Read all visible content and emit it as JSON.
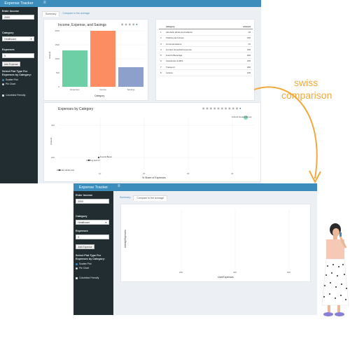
{
  "top": {
    "app_title": "Expense Tracker",
    "hamburger": "≡",
    "sidebar": {
      "income_label": "Enter Income",
      "income_value": "2000",
      "category_label": "Category",
      "category_value": "Healthcare",
      "expense_label": "Expenses",
      "expense_value": "5",
      "add_button": "Add Expense",
      "plot_type_label": "Select Plot Type For Expenses by Category:",
      "plot_options": [
        "Scatter Plot",
        "Pie Chart"
      ],
      "plot_selected": "Scatter Plot",
      "colorblind_label": "Colorblind Friendly"
    },
    "tabs": [
      "Summary",
      "Compare to the average"
    ],
    "active_tab": "Summary",
    "bar_chart": {
      "title": "Income, Expense, and Savings",
      "xlabel": "Category",
      "ylabel": "Amount",
      "categories": [
        "Expenses",
        "Income",
        "Savings"
      ],
      "values": [
        1300,
        2000,
        700
      ],
      "colors": [
        "#6ccfa5",
        "#fc8d62",
        "#8da0cb"
      ],
      "ylim": [
        0,
        2000
      ],
      "yticks": [
        "0",
        "500",
        "1000",
        "1500",
        "2000"
      ]
    },
    "table": {
      "headers": [
        "",
        "category",
        "amount"
      ],
      "rows": [
        [
          "1",
          "Alcoholic drinks and tobacco",
          "18"
        ],
        [
          "2",
          "Clothing and shoes",
          "150"
        ],
        [
          "3",
          "Communications",
          "15"
        ],
        [
          "4",
          "Current household expense",
          "150"
        ],
        [
          "5",
          "Food & Beverage",
          "200"
        ],
        [
          "6",
          "Insurances & ARS",
          "150"
        ],
        [
          "7",
          "Transport",
          "200"
        ],
        [
          "8",
          "Leisure",
          "100"
        ]
      ]
    },
    "scatter": {
      "title": "Expenses by Category",
      "xlabel": "% Share of Expenses",
      "ylabel": "Amount",
      "yticks": [
        "400",
        "200"
      ],
      "xticks": [
        "10",
        "20",
        "30",
        "40"
      ],
      "annotations": [
        "Current household exp",
        "Food & Bever",
        "Clothing and sh",
        "Alcoholic drinks and"
      ]
    }
  },
  "annotation": {
    "text_line1": "swiss",
    "text_line2": "comparison",
    "color": "#f1a93b"
  },
  "bottom": {
    "app_title": "Expense Tracker",
    "hamburger": "≡",
    "sidebar": {
      "income_label": "Enter Income",
      "income_value": "2000",
      "category_label": "Category",
      "category_value": "Healthcare",
      "expense_label": "Expenses",
      "expense_value": "0",
      "add_button": "Add Expense",
      "plot_type_label": "Select Plot Type For Expenses by Category:",
      "plot_options": [
        "Scatter Plot",
        "Pie Chart"
      ],
      "plot_selected": "Scatter Plot",
      "colorblind_label": "Colorblind Friendly"
    },
    "tabs": [
      "Summary",
      "Compare to the average"
    ],
    "active_tab": "Compare to the average",
    "chart": {
      "xlabel": "UserExpenses",
      "ylabel": "AverageExpenses",
      "xticks": [
        "200",
        "400",
        "600"
      ]
    }
  }
}
